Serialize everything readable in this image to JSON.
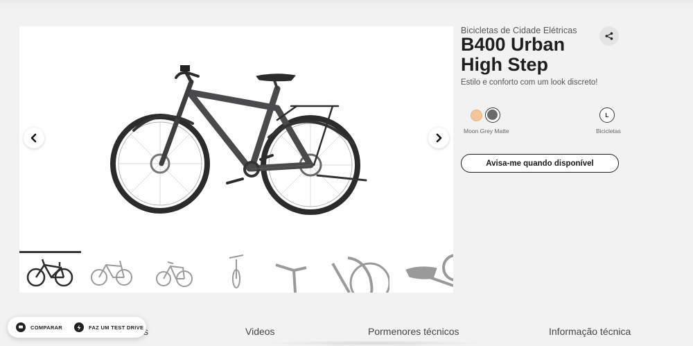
{
  "product": {
    "category": "Bicicletas de Cidade Elétricas",
    "title": "B400 Urban High Step",
    "tagline": "Estilo e conforto com um look discreto!",
    "colors": [
      {
        "name": "Moon Grey Matte",
        "hex": "#6b6b6b",
        "selected": true
      },
      {
        "name": "peach",
        "hex": "#f3c59b",
        "selected": false
      }
    ],
    "selected_color_label": "Moon Grey Matte",
    "size": {
      "value": "L",
      "label": "Bicicletas"
    },
    "notify_button": "Avisa-me quando disponível"
  },
  "gallery": {
    "thumbnail_count": 7,
    "active_thumbnail": 1
  },
  "tabs": [
    {
      "label": "s"
    },
    {
      "label": "Videos"
    },
    {
      "label": "Pormenores técnicos"
    },
    {
      "label": "Informação técnica"
    }
  ],
  "floating_bar": {
    "compare_label": "COMPARAR",
    "test_drive_label": "FAZ UM TEST DRIVE"
  },
  "colors": {
    "background": "#f2f2f2",
    "bike_frame": "#4a4a4c",
    "accent_dark": "#1a1a1a"
  },
  "icons": [
    "chevron-left-icon",
    "chevron-right-icon",
    "share-icon",
    "chat-icon",
    "bolt-icon"
  ]
}
